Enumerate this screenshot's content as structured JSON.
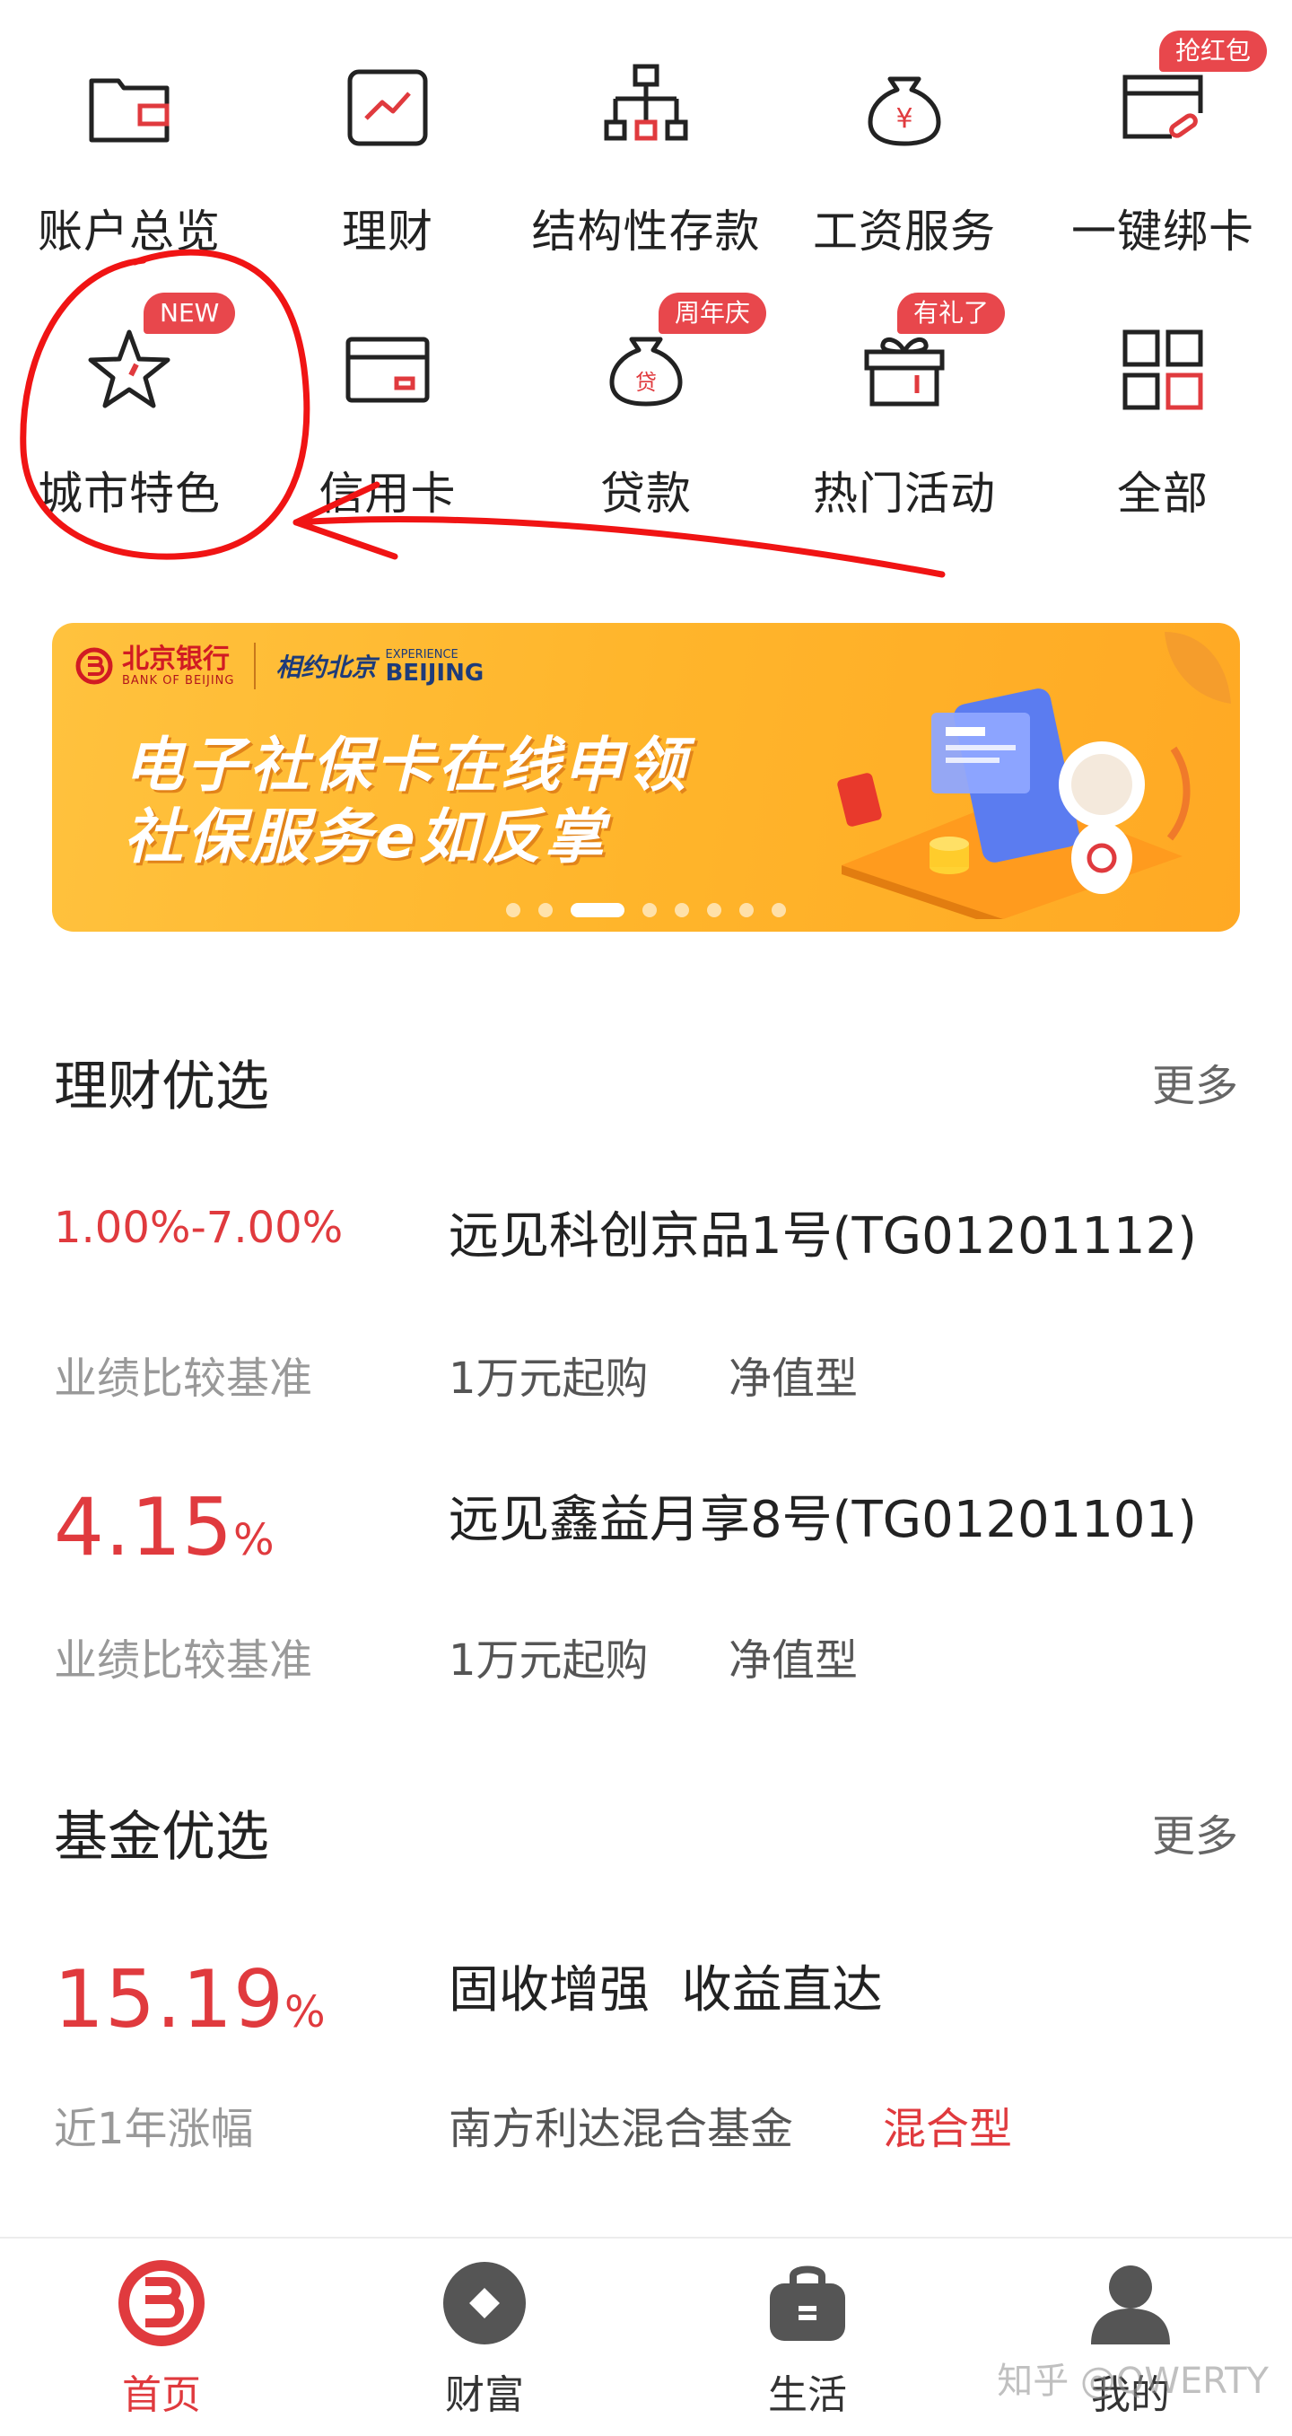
{
  "quick_menu": {
    "row1": [
      {
        "label": "账户总览",
        "icon": "wallet-icon"
      },
      {
        "label": "理财",
        "icon": "trend-chart-icon"
      },
      {
        "label": "结构性存款",
        "icon": "org-structure-icon"
      },
      {
        "label": "工资服务",
        "icon": "money-bag-icon"
      },
      {
        "label": "一键绑卡",
        "icon": "card-link-icon",
        "badge": "抢红包"
      }
    ],
    "row2": [
      {
        "label": "城市特色",
        "icon": "star-icon",
        "badge": "NEW"
      },
      {
        "label": "信用卡",
        "icon": "credit-card-icon"
      },
      {
        "label": "贷款",
        "icon": "loan-bag-icon",
        "badge": "周年庆"
      },
      {
        "label": "热门活动",
        "icon": "gift-icon",
        "badge": "有礼了"
      },
      {
        "label": "全部",
        "icon": "grid-all-icon"
      }
    ]
  },
  "banner": {
    "bank_name_cn": "北京银行",
    "bank_name_en": "BANK OF BEIJING",
    "partner_cn": "相约北京",
    "partner_en_top": "EXPERIENCE",
    "partner_en_bottom": "BEIJING",
    "line1": "电子社保卡在线申领",
    "line2": "社保服务e如反掌",
    "slide_count": 8,
    "active_slide": 3
  },
  "wealth": {
    "title": "理财优选",
    "more": "更多",
    "products": [
      {
        "rate": "1.00%-7.00%",
        "rate_label": "业绩比较基准",
        "name": "远见科创京品1号(TG01201112)",
        "min": "1万元起购",
        "type": "净值型"
      },
      {
        "rate_value": "4.15",
        "rate_unit": "%",
        "rate_label": "业绩比较基准",
        "name": "远见鑫益月享8号(TG01201101)",
        "min": "1万元起购",
        "type": "净值型"
      }
    ]
  },
  "fund": {
    "title": "基金优选",
    "more": "更多",
    "rate_value": "15.19",
    "rate_unit": "%",
    "rate_label": "近1年涨幅",
    "slogan": "固收增强  收益直达",
    "fund_name": "南方利达混合基金",
    "fund_type": "混合型"
  },
  "tabbar": {
    "tabs": [
      {
        "label": "首页",
        "icon": "bank-logo-icon",
        "active": true
      },
      {
        "label": "财富",
        "icon": "wealth-icon"
      },
      {
        "label": "生活",
        "icon": "life-bag-icon"
      },
      {
        "label": "我的",
        "icon": "profile-icon"
      }
    ]
  },
  "watermark": "知乎 @QWERTY",
  "colors": {
    "accent": "#e03a3e",
    "banner": "#ffb52b",
    "badge": "#e8474c"
  }
}
